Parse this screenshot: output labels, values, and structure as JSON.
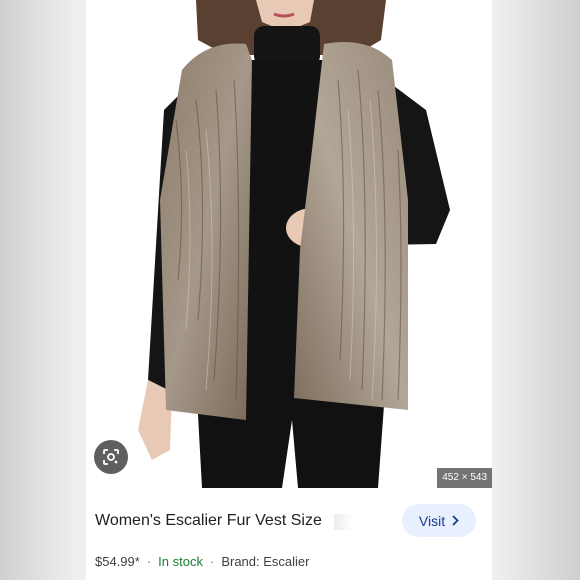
{
  "image_dimensions": "452 × 543",
  "product": {
    "title": "Women's Escalier Fur Vest Size",
    "price": "$54.99*",
    "stock": "In stock",
    "brand": "Brand: Escalier",
    "separator": "·"
  },
  "actions": {
    "visit_label": "Visit",
    "visit_icon": "chevron-right-icon",
    "lens_icon": "lens-search-icon"
  },
  "colors": {
    "visit_bg": "#e8f0fe",
    "visit_text": "#1a3b8e",
    "in_stock": "#188038"
  }
}
